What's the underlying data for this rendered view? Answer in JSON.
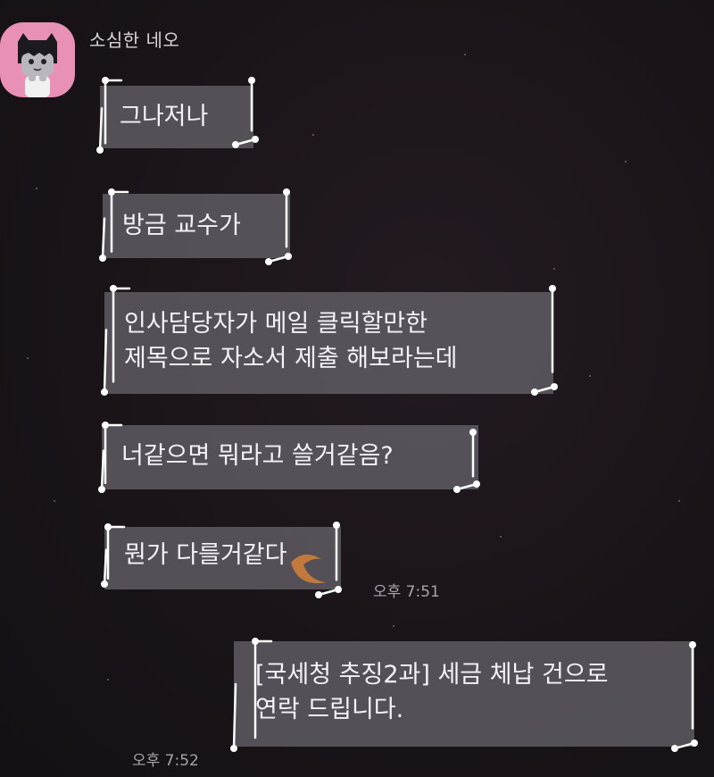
{
  "chat": {
    "sender_name": "소심한 네오",
    "avatar_icon": "neo-cat-icon",
    "messages": [
      {
        "text_lines": [
          "그나저나"
        ]
      },
      {
        "text_lines": [
          "방금 교수가"
        ]
      },
      {
        "text_lines": [
          "인사담당자가 메일 클릭할만한",
          "제목으로 자소서 제출 해보라는데"
        ]
      },
      {
        "text_lines": [
          "너같으면 뭐라고 쓸거같음?"
        ]
      },
      {
        "text_lines": [
          "뭔가 다를거같다"
        ]
      }
    ],
    "received_time": "오후 7:51",
    "sent_message": {
      "text_lines": [
        "[국세청 추징2과] 세금 체납 건으로",
        "연락 드립니다."
      ]
    },
    "sent_time": "오후 7:52"
  },
  "colors": {
    "background": "#1a1419",
    "avatar_bg": "#e990b7",
    "bubble": "#6c6870",
    "text": "#f4f2f6"
  }
}
